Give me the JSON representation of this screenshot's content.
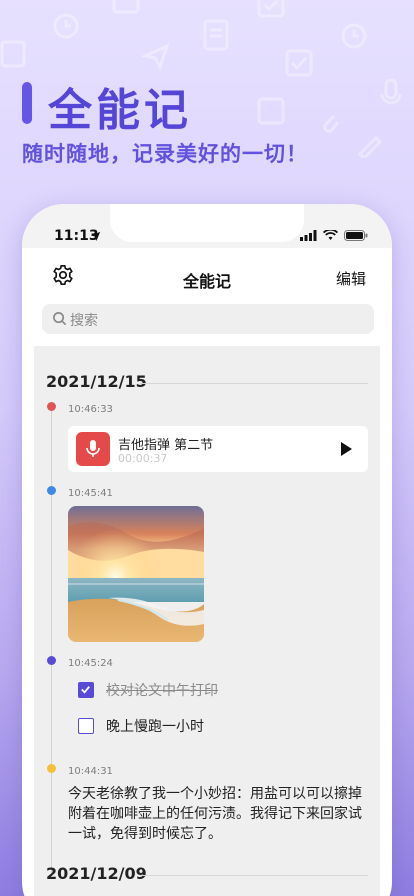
{
  "hero": {
    "title": "全能记",
    "subtitle": "随时随地，记录美好的一切！"
  },
  "status_bar": {
    "time": "11:13"
  },
  "header": {
    "title": "全能记",
    "edit_label": "编辑",
    "settings_icon": "gear-icon"
  },
  "search": {
    "placeholder": "搜索"
  },
  "colors": {
    "accent": "#5a4bd6",
    "audio_red": "#e44a4a",
    "dot_red": "#e05454",
    "dot_blue": "#3b8be6",
    "dot_purple": "#5a4bd6",
    "dot_yellow": "#f3c234"
  },
  "timeline": {
    "groups": [
      {
        "date": "2021/12/15",
        "entries": [
          {
            "time": "10:46:33",
            "type": "audio",
            "title": "吉他指弹 第二节",
            "duration": "00:00:37"
          },
          {
            "time": "10:45:41",
            "type": "image",
            "description": "beach-sunset-photo"
          },
          {
            "time": "10:45:24",
            "type": "todo",
            "items": [
              {
                "text": "校对论文中午打印",
                "checked": true
              },
              {
                "text": "晚上慢跑一小时",
                "checked": false
              }
            ]
          },
          {
            "time": "10:44:31",
            "type": "text",
            "body": "今天老徐教了我一个小妙招：用盐可以可以擦掉附着在咖啡壶上的任何污渍。我得记下来回家试一试，免得到时候忘了。"
          }
        ]
      },
      {
        "date": "2021/12/09",
        "entries": []
      }
    ]
  }
}
